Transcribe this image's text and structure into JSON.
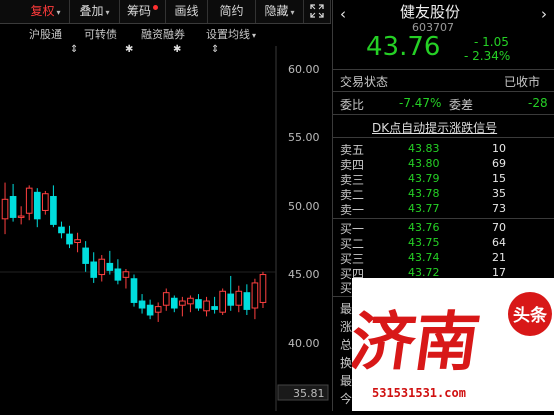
{
  "toolbar": {
    "items": [
      {
        "label": "复权"
      },
      {
        "label": "叠加"
      },
      {
        "label": "筹码"
      },
      {
        "label": "画线"
      },
      {
        "label": "简约"
      },
      {
        "label": "隐藏"
      }
    ],
    "fullscreen_icon": "expand-icon"
  },
  "toolbar2": {
    "items": [
      {
        "label": "沪股通"
      },
      {
        "label": "可转债"
      },
      {
        "label": "融资融券"
      },
      {
        "label": "设置均线"
      }
    ]
  },
  "chart_data": {
    "type": "candlestick",
    "ylim": [
      35.81,
      62
    ],
    "y_ticks": [
      "60.00",
      "55.00",
      "50.00",
      "45.00",
      "40.00"
    ],
    "low_label": "35.81",
    "candles": [
      {
        "o": 49.6,
        "h": 52.2,
        "l": 48.5,
        "c": 51.0
      },
      {
        "o": 51.2,
        "h": 52.1,
        "l": 49.4,
        "c": 49.7
      },
      {
        "o": 49.7,
        "h": 50.5,
        "l": 49.2,
        "c": 49.8
      },
      {
        "o": 50.0,
        "h": 52.0,
        "l": 49.5,
        "c": 51.8
      },
      {
        "o": 51.5,
        "h": 51.8,
        "l": 49.0,
        "c": 49.6
      },
      {
        "o": 50.2,
        "h": 51.6,
        "l": 49.9,
        "c": 51.4
      },
      {
        "o": 51.2,
        "h": 52.0,
        "l": 49.0,
        "c": 49.2
      },
      {
        "o": 49.0,
        "h": 49.4,
        "l": 48.2,
        "c": 48.6
      },
      {
        "o": 48.5,
        "h": 49.1,
        "l": 47.5,
        "c": 47.8
      },
      {
        "o": 47.9,
        "h": 48.6,
        "l": 47.2,
        "c": 48.1
      },
      {
        "o": 47.5,
        "h": 48.0,
        "l": 45.8,
        "c": 46.4
      },
      {
        "o": 46.5,
        "h": 47.2,
        "l": 45.0,
        "c": 45.4
      },
      {
        "o": 45.6,
        "h": 47.0,
        "l": 45.1,
        "c": 46.7
      },
      {
        "o": 46.4,
        "h": 47.3,
        "l": 45.6,
        "c": 45.9
      },
      {
        "o": 46.0,
        "h": 46.7,
        "l": 44.9,
        "c": 45.2
      },
      {
        "o": 45.4,
        "h": 46.0,
        "l": 44.6,
        "c": 45.8
      },
      {
        "o": 45.3,
        "h": 45.6,
        "l": 43.3,
        "c": 43.6
      },
      {
        "o": 43.7,
        "h": 44.2,
        "l": 42.8,
        "c": 43.2
      },
      {
        "o": 43.4,
        "h": 43.8,
        "l": 42.4,
        "c": 42.7
      },
      {
        "o": 42.9,
        "h": 43.6,
        "l": 42.2,
        "c": 43.3
      },
      {
        "o": 43.4,
        "h": 44.6,
        "l": 43.0,
        "c": 44.3
      },
      {
        "o": 43.9,
        "h": 44.1,
        "l": 42.9,
        "c": 43.2
      },
      {
        "o": 43.4,
        "h": 44.0,
        "l": 42.6,
        "c": 43.7
      },
      {
        "o": 43.5,
        "h": 44.1,
        "l": 42.9,
        "c": 43.9
      },
      {
        "o": 43.8,
        "h": 44.2,
        "l": 43.0,
        "c": 43.2
      },
      {
        "o": 43.0,
        "h": 44.0,
        "l": 42.6,
        "c": 43.7
      },
      {
        "o": 43.3,
        "h": 44.0,
        "l": 42.8,
        "c": 43.1
      },
      {
        "o": 42.9,
        "h": 44.6,
        "l": 42.7,
        "c": 44.4
      },
      {
        "o": 44.2,
        "h": 45.5,
        "l": 43.0,
        "c": 43.4
      },
      {
        "o": 43.4,
        "h": 44.8,
        "l": 42.9,
        "c": 44.4
      },
      {
        "o": 44.3,
        "h": 44.9,
        "l": 42.7,
        "c": 43.1
      },
      {
        "o": 43.2,
        "h": 45.3,
        "l": 42.4,
        "c": 45.0
      },
      {
        "o": 43.6,
        "h": 45.8,
        "l": 43.2,
        "c": 45.6
      }
    ]
  },
  "panel": {
    "stock_name": "健友股份",
    "stock_code": "603707",
    "price": "43.76",
    "change": "- 1.05",
    "change_pct": "- 2.34%",
    "trade_status_label": "交易状态",
    "trade_status_value": "已收市",
    "ratio_label": "委比",
    "ratio_value": "-7.47%",
    "diff_label": "委差",
    "diff_value": "-28",
    "dk_title": "DK点自动提示涨跌信号",
    "sells": [
      {
        "label": "卖五",
        "price": "43.83",
        "vol": "10"
      },
      {
        "label": "卖四",
        "price": "43.80",
        "vol": "69"
      },
      {
        "label": "卖三",
        "price": "43.79",
        "vol": "15"
      },
      {
        "label": "卖二",
        "price": "43.78",
        "vol": "35"
      },
      {
        "label": "卖一",
        "price": "43.77",
        "vol": "73"
      }
    ],
    "buys": [
      {
        "label": "买一",
        "price": "43.76",
        "vol": "70"
      },
      {
        "label": "买二",
        "price": "43.75",
        "vol": "64"
      },
      {
        "label": "买三",
        "price": "43.74",
        "vol": "21"
      },
      {
        "label": "买四",
        "price": "43.72",
        "vol": "17"
      },
      {
        "label": "买五"
      }
    ],
    "stats_labels": [
      "最新",
      "涨幅",
      "总手",
      "换手",
      "最高",
      "今开"
    ]
  },
  "watermark": {
    "chars": "济南",
    "badge": "头条",
    "url": "531531531.com"
  },
  "colors": {
    "up": "#ff4040",
    "down": "#00dede",
    "price_green": "#25d025",
    "grid": "#3a3a3a"
  }
}
